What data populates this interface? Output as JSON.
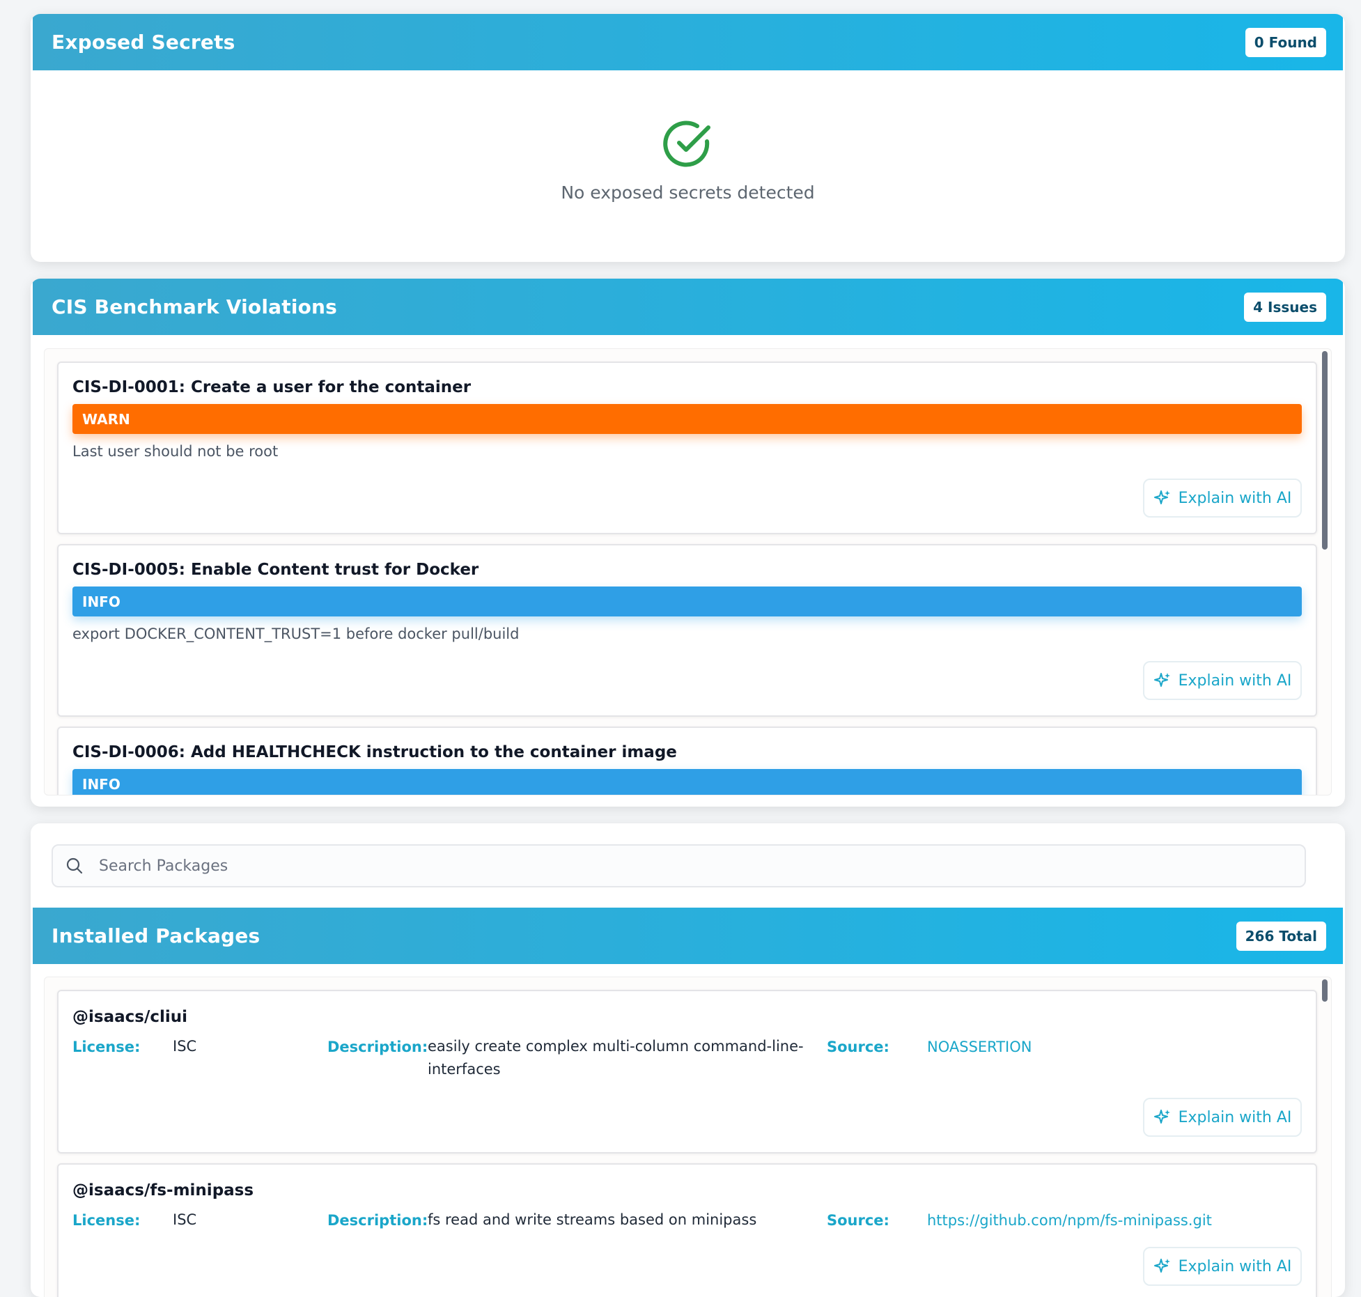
{
  "secrets": {
    "title": "Exposed Secrets",
    "badge": "0 Found",
    "empty_message": "No exposed secrets detected",
    "icon": "check-circle-icon"
  },
  "cis": {
    "title": "CIS Benchmark Violations",
    "badge": "4 Issues",
    "items": [
      {
        "title": "CIS-DI-0001: Create a user for the container",
        "severity": "WARN",
        "description": "Last user should not be root",
        "button": "Explain with AI"
      },
      {
        "title": "CIS-DI-0005: Enable Content trust for Docker",
        "severity": "INFO",
        "description": "export DOCKER_CONTENT_TRUST=1 before docker pull/build",
        "button": "Explain with AI"
      },
      {
        "title": "CIS-DI-0006: Add HEALTHCHECK instruction to the container image",
        "severity": "INFO"
      }
    ]
  },
  "search": {
    "placeholder": "Search Packages"
  },
  "packages": {
    "title": "Installed Packages",
    "badge": "266 Total",
    "labels": {
      "license": "License:",
      "description": "Description:",
      "source": "Source:"
    },
    "items": [
      {
        "name": "@isaacs/cliui",
        "license": "ISC",
        "description": "easily create complex multi-column command-line-interfaces",
        "source": "NOASSERTION",
        "button": "Explain with AI"
      },
      {
        "name": "@isaacs/fs-minipass",
        "license": "ISC",
        "description": "fs read and write streams based on minipass",
        "source": "https://github.com/npm/fs-minipass.git",
        "button": "Explain with AI"
      }
    ]
  },
  "colors": {
    "header_start": "#3aa8cf",
    "header_end": "#19b6e8",
    "warn": "#ff6d00",
    "info": "#2f9fe6",
    "accent": "#1aa6c9",
    "success": "#2e9e48"
  }
}
